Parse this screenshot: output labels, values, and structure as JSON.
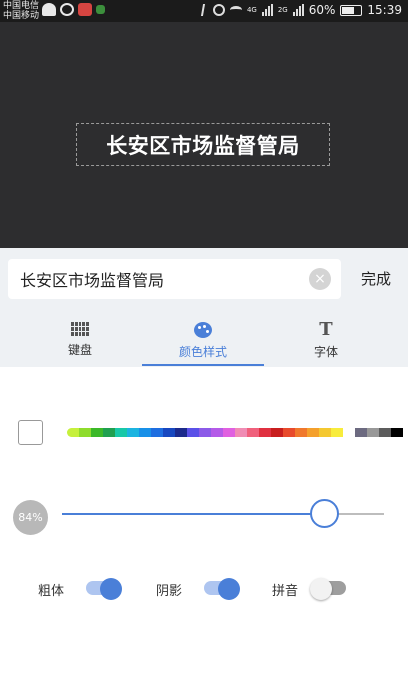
{
  "status_bar": {
    "carrier_1": "中国电信",
    "carrier_2": "中国移动",
    "network_1": "4G",
    "network_2": "2G",
    "battery": "60%",
    "time": "15:39"
  },
  "preview": {
    "text": "长安区市场监督管局"
  },
  "editor": {
    "input_value": "长安区市场监督管局",
    "clear_icon": "×",
    "done_label": "完成"
  },
  "tabs": [
    {
      "label": "键盘",
      "icon": "keyboard-icon",
      "active": false
    },
    {
      "label": "颜色样式",
      "icon": "palette-icon",
      "active": true
    },
    {
      "label": "字体",
      "icon": "font-icon",
      "active": false
    }
  ],
  "colors": {
    "accent": "#4a7fd8",
    "swatches": [
      "#c6f03c",
      "#8fdc2c",
      "#3cb828",
      "#20a050",
      "#18c8a8",
      "#1cb4e0",
      "#1890e8",
      "#1e6ee0",
      "#1848c0",
      "#1c2a8c",
      "#5a50e8",
      "#8c5ae8",
      "#b45ae8",
      "#e060e0",
      "#f08cb4",
      "#f0607c",
      "#e03040",
      "#c81e1e",
      "#e84a2c",
      "#f0782c",
      "#f4a02c",
      "#f4c830",
      "#f8ec3c",
      "#ffffff",
      "#6c6a80",
      "#989898",
      "#5c5c5c",
      "#000000"
    ]
  },
  "opacity": {
    "label": "84%",
    "value": 0.84
  },
  "toggles": [
    {
      "label": "粗体",
      "on": true
    },
    {
      "label": "阴影",
      "on": true
    },
    {
      "label": "拼音",
      "on": false
    }
  ]
}
